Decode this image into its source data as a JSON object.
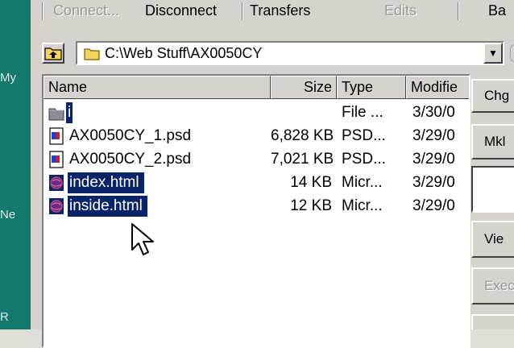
{
  "left_strip": {
    "labels": [
      "My",
      "Ne",
      "R"
    ]
  },
  "toolbar": {
    "items": [
      {
        "label": "Connect...",
        "enabled": false
      },
      {
        "label": "Disconnect",
        "enabled": true
      },
      {
        "label": "Transfers",
        "enabled": true
      },
      {
        "label": "Edits",
        "enabled": false
      },
      {
        "label": "Ba",
        "enabled": true
      }
    ]
  },
  "path": {
    "value": "C:\\Web Stuff\\AX0050CY"
  },
  "columns": [
    "Name",
    "Size",
    "Type",
    "Modifie"
  ],
  "files": [
    {
      "name": "i",
      "size": "",
      "type": "File ...",
      "modified": "3/30/0",
      "icon": "folder-icon",
      "selected": true
    },
    {
      "name": "AX0050CY_1.psd",
      "size": "6,828 KB",
      "type": "PSD...",
      "modified": "3/29/0",
      "icon": "psd-file-icon",
      "selected": false
    },
    {
      "name": "AX0050CY_2.psd",
      "size": "7,021 KB",
      "type": "PSD...",
      "modified": "3/29/0",
      "icon": "psd-file-icon",
      "selected": false
    },
    {
      "name": "index.html",
      "size": "14 KB",
      "type": "Micr...",
      "modified": "3/29/0",
      "icon": "html-file-icon",
      "selected": true
    },
    {
      "name": "inside.html",
      "size": "12 KB",
      "type": "Micr...",
      "modified": "3/29/0",
      "icon": "html-file-icon",
      "selected": true
    }
  ],
  "side_buttons": {
    "chgdir": "Chg",
    "mkdir": "Mkl",
    "view": "Vie",
    "exec": "Exec"
  },
  "colors": {
    "selection": "#0a246a",
    "teal": "#14786e",
    "face": "#d6d3ce"
  }
}
